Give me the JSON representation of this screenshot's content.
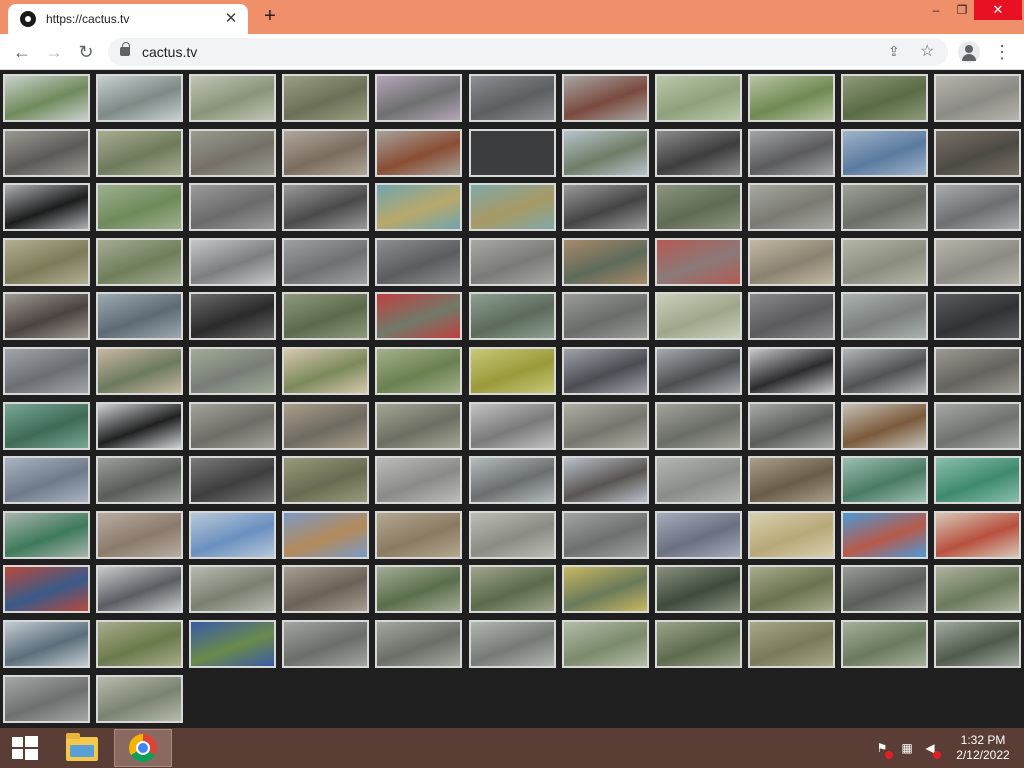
{
  "browser": {
    "tab": {
      "title": "https://cactus.tv",
      "close_glyph": "✕"
    },
    "new_tab_glyph": "+",
    "window_controls": {
      "minimize": "–",
      "maximize": "❐",
      "close": "✕"
    },
    "nav": {
      "back": "←",
      "forward": "→",
      "reload": "↻"
    },
    "url": "cactus.tv",
    "share_glyph": "⇪",
    "star_glyph": "☆",
    "menu_glyph": "⋮"
  },
  "camera_grid": {
    "rows": 12,
    "cols": 11,
    "last_row_count": 2,
    "frame_color": "#d8d8d8",
    "background": "#1f1f1f",
    "feeds": [
      [
        "#6f8a5c",
        "#c9d2cc"
      ],
      [
        "#7d8a86",
        "#c7d0cf"
      ],
      [
        "#8a9479",
        "#bfc6b6"
      ],
      [
        "#6b6f57",
        "#9aa082"
      ],
      [
        "#6e6f70",
        "#b4a6b8"
      ],
      [
        "#5c5e61",
        "#8c8f93"
      ],
      [
        "#7a4a3e",
        "#a8a6a4"
      ],
      [
        "#8ea07c",
        "#b9c9a8"
      ],
      [
        "#6f8a52",
        "#b8c4a4"
      ],
      [
        "#5a6b45",
        "#8f9a7a"
      ],
      [
        "#8b8b86",
        "#b7b5ab"
      ],
      [
        "#5b5a57",
        "#9a9992"
      ],
      [
        "#6e7a5a",
        "#a7ad92"
      ],
      [
        "#747066",
        "#9c9a8f"
      ],
      [
        "#7a6c5e",
        "#b0a89a"
      ],
      [
        "#8a4d34",
        "#a6a29a"
      ],
      [
        "#3c3d3e",
        "#3c3d3e"
      ],
      [
        "#6f7c66",
        "#b6c5cc"
      ],
      [
        "#3d3d3e",
        "#8c8c8c"
      ],
      [
        "#5b5b5c",
        "#a2a4a8"
      ],
      [
        "#5a7aa0",
        "#9fb4c8"
      ],
      [
        "#4d4a44",
        "#787066"
      ],
      [
        "#1c1c1c",
        "#aeb2b5"
      ],
      [
        "#6d8a5a",
        "#9fb08f"
      ],
      [
        "#6a6a6a",
        "#9b9b9b"
      ],
      [
        "#4a4a4a",
        "#9a9a9a"
      ],
      [
        "#b9a86a",
        "#6fa6b0"
      ],
      [
        "#a89a64",
        "#7fa8a8"
      ],
      [
        "#444444",
        "#9a9a9a"
      ],
      [
        "#606b55",
        "#8b9580"
      ],
      [
        "#7a7a72",
        "#a6a8a2"
      ],
      [
        "#6a6e66",
        "#9ea29a"
      ],
      [
        "#6d6e70",
        "#a8acb0"
      ],
      [
        "#7d7a58",
        "#b2b092"
      ],
      [
        "#6f7e5a",
        "#a4ac92"
      ],
      [
        "#7a7e7e",
        "#c4c8c8"
      ],
      [
        "#6f7072",
        "#9fa0a2"
      ],
      [
        "#5a5c60",
        "#8c8e92"
      ],
      [
        "#7a7a78",
        "#a8a8a4"
      ],
      [
        "#5e6a5a",
        "#a88a6a"
      ],
      [
        "#8a7a78",
        "#b55a54"
      ],
      [
        "#8a8270",
        "#c2b8a4"
      ],
      [
        "#8a8c7e",
        "#b4b6a6"
      ],
      [
        "#8c8a84",
        "#b8b4aa"
      ],
      [
        "#4a4340",
        "#9e9892"
      ],
      [
        "#5d6a74",
        "#9eaab0"
      ],
      [
        "#2a2a2a",
        "#6a6a6a"
      ],
      [
        "#5c6a4c",
        "#8e9a7a"
      ],
      [
        "#707a6a",
        "#c04040"
      ],
      [
        "#5d6a5c",
        "#8ca090"
      ],
      [
        "#6a6c6a",
        "#9a9c98"
      ],
      [
        "#9ea68a",
        "#c9d0bc"
      ],
      [
        "#5a5a5c",
        "#8a8a8c"
      ],
      [
        "#7a7e7c",
        "#aab2b0"
      ],
      [
        "#303234",
        "#5a5c60"
      ],
      [
        "#6a6e72",
        "#a2a6aa"
      ],
      [
        "#6c7a5e",
        "#c9b8a0"
      ],
      [
        "#777d77",
        "#a2ab96"
      ],
      [
        "#7a8a5a",
        "#d8c8b0"
      ],
      [
        "#6a8050",
        "#a4b08c"
      ],
      [
        "#9a9a3a",
        "#c8c87a"
      ],
      [
        "#4a4c52",
        "#a0a4aa"
      ],
      [
        "#4c4e52",
        "#a6aaae"
      ],
      [
        "#2c2c2e",
        "#c8c8cc"
      ],
      [
        "#505256",
        "#b4b6ba"
      ],
      [
        "#64635e",
        "#9c9a92"
      ],
      [
        "#3e6a56",
        "#7aa894"
      ],
      [
        "#202020",
        "#cfd2d4"
      ],
      [
        "#6e6c66",
        "#a4a29a"
      ],
      [
        "#6e6a60",
        "#aa9e8a"
      ],
      [
        "#6c6e62",
        "#a4a694"
      ],
      [
        "#7a7a7a",
        "#c2c2c2"
      ],
      [
        "#76766e",
        "#aeaea4"
      ],
      [
        "#6a6c66",
        "#a2a49c"
      ],
      [
        "#5c5e5c",
        "#a8aaa8"
      ],
      [
        "#7a5a3a",
        "#c6c2b8"
      ],
      [
        "#707270",
        "#a6a8a4"
      ],
      [
        "#6e7a8a",
        "#aab4c2"
      ],
      [
        "#5a5c5a",
        "#9ea09a"
      ],
      [
        "#3e3e3e",
        "#7a7a7a"
      ],
      [
        "#6a6a52",
        "#9a9a7a"
      ],
      [
        "#8a8a88",
        "#bcbcba"
      ],
      [
        "#6a6e6e",
        "#b4bcbe"
      ],
      [
        "#5a5450",
        "#b8c2cc"
      ],
      [
        "#8a8c88",
        "#b4b6b2"
      ],
      [
        "#6a5c48",
        "#a8a08c"
      ],
      [
        "#4a7a64",
        "#9cc0b0"
      ],
      [
        "#3e8a6e",
        "#8abfae"
      ],
      [
        "#3e7a5a",
        "#a8b4ae"
      ],
      [
        "#8a7a6a",
        "#b8aea2"
      ],
      [
        "#6a90c0",
        "#b8c8d8"
      ],
      [
        "#b48a5a",
        "#7a9ac8"
      ],
      [
        "#8a7a62",
        "#b4a890"
      ],
      [
        "#8a8c84",
        "#bcbeb6"
      ],
      [
        "#6e7070",
        "#a2a4a4"
      ],
      [
        "#6a7080",
        "#a6acbc"
      ],
      [
        "#b8a878",
        "#d8d0b0"
      ],
      [
        "#b85a4a",
        "#4a9ad8"
      ],
      [
        "#b8503e",
        "#d8c8b8"
      ],
      [
        "#3a5a8a",
        "#b84a3a"
      ],
      [
        "#5a5e62",
        "#c8cccf"
      ],
      [
        "#7a8070",
        "#b6bab0"
      ],
      [
        "#6a6258",
        "#a89e92"
      ],
      [
        "#5a6e4a",
        "#a4ac96"
      ],
      [
        "#5a6a4a",
        "#a0a48c"
      ],
      [
        "#6a7a5a",
        "#c8b862"
      ],
      [
        "#3e4a3a",
        "#8a9080"
      ],
      [
        "#6a7250",
        "#a8ac8c"
      ],
      [
        "#5a5e58",
        "#9a9c96"
      ],
      [
        "#6a7a5a",
        "#aeb29e"
      ],
      [
        "#5a6e7a",
        "#c4ccd2"
      ],
      [
        "#6a7a4a",
        "#a8ac8c"
      ],
      [
        "#6a8a4a",
        "#3a5aa8"
      ],
      [
        "#6a6e6a",
        "#a2a6a2"
      ],
      [
        "#6a6e66",
        "#a4a8a0"
      ],
      [
        "#767a76",
        "#b2b6b0"
      ],
      [
        "#7a8a6a",
        "#b4bca8"
      ],
      [
        "#5e6a4e",
        "#9aa48a"
      ],
      [
        "#7a7a5a",
        "#a8a88a"
      ],
      [
        "#6a7a5e",
        "#a6b09a"
      ],
      [
        "#4e5a4a",
        "#a2aaa0"
      ],
      [
        "#6e7070",
        "#a6a8a8"
      ],
      [
        "#7a8270",
        "#b6bcae"
      ]
    ]
  },
  "taskbar": {
    "time": "1:32 PM",
    "date": "2/12/2022",
    "tray": {
      "flag": "⚑",
      "network": "▦",
      "volume": "◀"
    }
  }
}
